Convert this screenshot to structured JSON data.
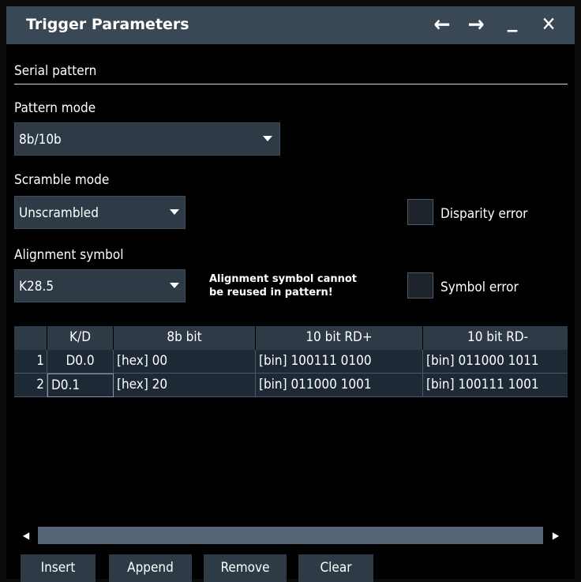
{
  "window": {
    "title": "Trigger Parameters",
    "controls": {
      "back": "←",
      "forward": "→",
      "minimize": "_",
      "close": "✕"
    }
  },
  "section": {
    "title": "Serial pattern"
  },
  "pattern_mode": {
    "label": "Pattern mode",
    "value": "8b/10b"
  },
  "scramble_mode": {
    "label": "Scramble mode",
    "value": "Unscrambled"
  },
  "alignment_symbol": {
    "label": "Alignment symbol",
    "value": "K28.5",
    "note_line1": "Alignment symbol cannot",
    "note_line2": "be reused in pattern!"
  },
  "checkboxes": {
    "disparity_error": {
      "label": "Disparity error",
      "checked": false
    },
    "symbol_error": {
      "label": "Symbol error",
      "checked": false
    }
  },
  "table": {
    "columns": [
      "K/D",
      "8b bit",
      "10 bit RD+",
      "10 bit RD-"
    ],
    "rows": [
      {
        "num": "1",
        "kd": "D0.0",
        "b8": "[hex] 00",
        "rdplus": "[bin] 100111 0100",
        "rdminus": "[bin] 011000 1011"
      },
      {
        "num": "2",
        "kd": "D0.1",
        "b8": "[hex] 20",
        "rdplus": "[bin] 011000 1001",
        "rdminus": "[bin] 100111 1001"
      }
    ]
  },
  "scrollbar": {
    "left": "◀",
    "right": "▶"
  },
  "buttons": {
    "insert": "Insert",
    "append": "Append",
    "remove": "Remove",
    "clear": "Clear"
  },
  "colors": {
    "titlebar": "#3a4755",
    "control_bg": "#2e3b47",
    "table_row_bg": "#1d2a36",
    "scroll_track": "#556575",
    "background": "#000000"
  }
}
